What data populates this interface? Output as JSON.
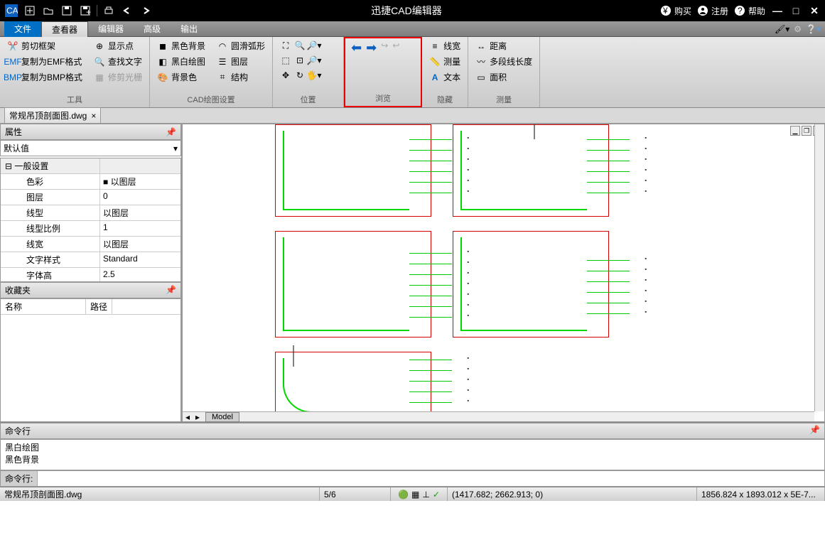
{
  "app_title": "迅捷CAD编辑器",
  "qat": [
    "cad",
    "new",
    "open",
    "save",
    "saveas",
    "print",
    "undo",
    "redo"
  ],
  "title_links": {
    "buy": "购买",
    "register": "注册",
    "help": "帮助"
  },
  "menu": {
    "file": "文件",
    "viewer": "查看器",
    "editor": "编辑器",
    "advanced": "高级",
    "output": "输出"
  },
  "ribbon": {
    "tools": {
      "label": "工具",
      "items": [
        "剪切框架",
        "复制为EMF格式",
        "复制为BMP格式",
        "显示点",
        "查找文字",
        "修剪光栅"
      ]
    },
    "cad": {
      "label": "CAD绘图设置",
      "items": [
        "黑色背景",
        "黑白绘图",
        "背景色",
        "圆滑弧形",
        "图层",
        "结构"
      ]
    },
    "pos": {
      "label": "位置"
    },
    "browse": {
      "label": "浏览"
    },
    "hide": {
      "label": "隐藏",
      "items": [
        "线宽",
        "测量",
        "文本"
      ]
    },
    "measure": {
      "label": "测量",
      "items": [
        "距离",
        "多段线长度",
        "面积"
      ]
    }
  },
  "file_tab": "常规吊顶剖面图.dwg",
  "props": {
    "title": "属性",
    "default": "默认值",
    "section": "一般设置",
    "rows": [
      {
        "k": "色彩",
        "v": "■ 以图层"
      },
      {
        "k": "图层",
        "v": "0"
      },
      {
        "k": "线型",
        "v": "以图层"
      },
      {
        "k": "线型比例",
        "v": "1"
      },
      {
        "k": "线宽",
        "v": "以图层"
      },
      {
        "k": "文字样式",
        "v": "Standard"
      },
      {
        "k": "字体高",
        "v": "2.5"
      }
    ]
  },
  "fav": {
    "title": "收藏夹",
    "cols": [
      "名称",
      "路径"
    ]
  },
  "layout_tab": "Model",
  "cmd": {
    "title": "命令行",
    "log": [
      "黑白绘图",
      "黑色背景"
    ],
    "prompt": "命令行:"
  },
  "status": {
    "file": "常规吊顶剖面图.dwg",
    "page": "5/6",
    "coords": "(1417.682; 2662.913; 0)",
    "dim": "1856.824 x 1893.012 x 5E-7..."
  }
}
